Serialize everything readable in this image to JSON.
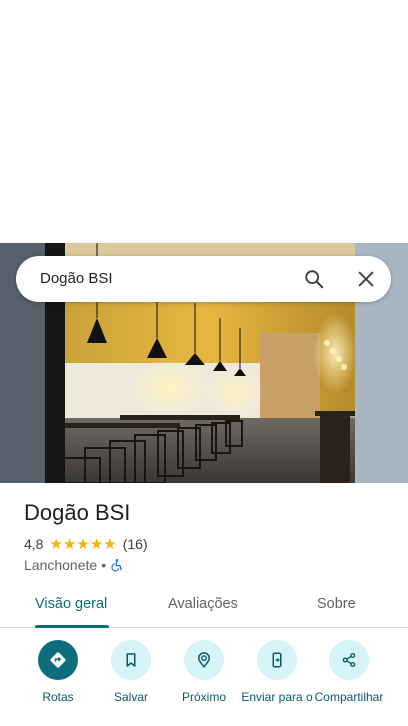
{
  "search": {
    "query": "Dogão BSI"
  },
  "place": {
    "name": "Dogão BSI",
    "rating": "4,8",
    "stars": 5,
    "review_count": "(16)",
    "category": "Lanchonete",
    "separator": "•"
  },
  "tabs": [
    {
      "label": "Visão geral",
      "active": true
    },
    {
      "label": "Avaliações",
      "active": false
    },
    {
      "label": "Sobre",
      "active": false
    }
  ],
  "actions": [
    {
      "label": "Rotas",
      "icon": "directions-icon"
    },
    {
      "label": "Salvar",
      "icon": "bookmark-icon"
    },
    {
      "label": "Próximo",
      "icon": "nearby-icon"
    },
    {
      "label": "Enviar para o",
      "icon": "send-to-phone-icon"
    },
    {
      "label": "Compartilhar",
      "icon": "share-icon"
    }
  ],
  "colors": {
    "accent": "#0b6e7a",
    "action_bg": "#d6f4f7",
    "star": "#f5b400",
    "accessibility": "#1a73e8"
  }
}
